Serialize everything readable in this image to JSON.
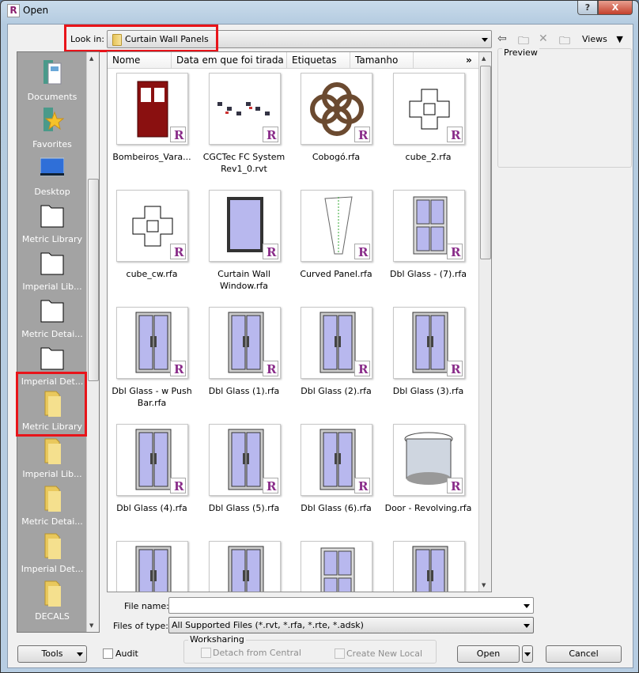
{
  "window": {
    "title": "Open",
    "app_icon": "R",
    "help": "?",
    "close": "X"
  },
  "lookin": {
    "label": "Look in:",
    "value": "Curtain Wall Panels"
  },
  "toolbar": {
    "back": "back-icon",
    "up": "up-folder-icon",
    "delete": "delete-icon",
    "new_folder": "new-folder-icon",
    "views": "Views"
  },
  "preview": {
    "label": "Preview"
  },
  "sidebar": {
    "items": [
      {
        "label": "Documents",
        "icon": "documents"
      },
      {
        "label": "Favorites",
        "icon": "favorites"
      },
      {
        "label": "Desktop",
        "icon": "desktop"
      },
      {
        "label": "Metric Library",
        "icon": "folder-white"
      },
      {
        "label": "Imperial Lib...",
        "icon": "folder-white"
      },
      {
        "label": "Metric Detai...",
        "icon": "folder-white"
      },
      {
        "label": "Imperial Det...",
        "icon": "folder-white"
      },
      {
        "label": "Metric Library",
        "icon": "folder-yellow"
      },
      {
        "label": "Imperial Lib...",
        "icon": "folder-yellow"
      },
      {
        "label": "Metric Detai...",
        "icon": "folder-yellow"
      },
      {
        "label": "Imperial Det...",
        "icon": "folder-yellow"
      },
      {
        "label": "DECALS",
        "icon": "folder-yellow"
      }
    ]
  },
  "columns": [
    "Nome",
    "Data em que foi tirada",
    "Etiquetas",
    "Tamanho"
  ],
  "more_columns": "»",
  "files": [
    {
      "name": "Bombeiros_Vara...",
      "kind": "red-door"
    },
    {
      "name": "CGCTec FC System Rev1_0.rvt",
      "kind": "site"
    },
    {
      "name": "Cobogó.rfa",
      "kind": "cobogo"
    },
    {
      "name": "cube_2.rfa",
      "kind": "cube"
    },
    {
      "name": "cube_cw.rfa",
      "kind": "cube"
    },
    {
      "name": "Curtain Wall Window.rfa",
      "kind": "window"
    },
    {
      "name": "Curved Panel.rfa",
      "kind": "curved"
    },
    {
      "name": "Dbl Glass - (7).rfa",
      "kind": "dbl-window"
    },
    {
      "name": "Dbl Glass - w Push Bar.rfa",
      "kind": "dbl-door"
    },
    {
      "name": "Dbl Glass (1).rfa",
      "kind": "dbl-door"
    },
    {
      "name": "Dbl Glass (2).rfa",
      "kind": "dbl-door"
    },
    {
      "name": "Dbl Glass (3).rfa",
      "kind": "dbl-door"
    },
    {
      "name": "Dbl Glass (4).rfa",
      "kind": "dbl-door"
    },
    {
      "name": "Dbl Glass (5).rfa",
      "kind": "dbl-door"
    },
    {
      "name": "Dbl Glass (6).rfa",
      "kind": "dbl-door"
    },
    {
      "name": "Door - Revolving.rfa",
      "kind": "revolving"
    },
    {
      "name": "",
      "kind": "dbl-door"
    },
    {
      "name": "",
      "kind": "dbl-door"
    },
    {
      "name": "",
      "kind": "dbl-window"
    },
    {
      "name": "",
      "kind": "dbl-door"
    }
  ],
  "filename": {
    "label": "File name:",
    "value": ""
  },
  "filetype": {
    "label": "Files of type:",
    "value": "All Supported Files  (*.rvt,  *.rfa,  *.rte,  *.adsk)"
  },
  "worksharing": {
    "label": "Worksharing",
    "detach": "Detach from Central",
    "create_local": "Create New Local"
  },
  "buttons": {
    "tools": "Tools",
    "audit": "Audit",
    "open": "Open",
    "cancel": "Cancel"
  },
  "colors": {
    "highlight": "#e8141a",
    "sidebar_bg": "#a3a3a3",
    "glass": "#b8b8ee"
  }
}
